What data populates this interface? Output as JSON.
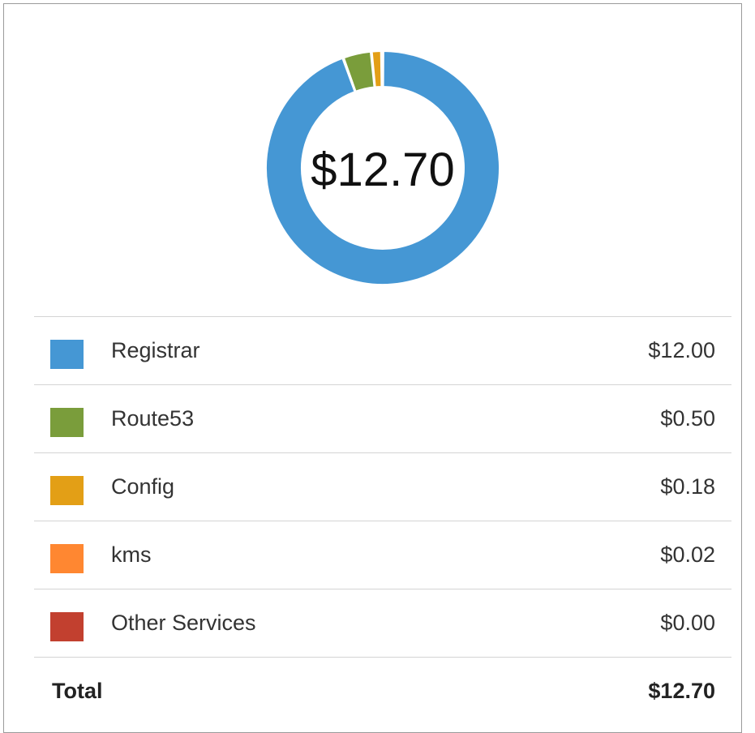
{
  "chart_data": {
    "type": "pie",
    "center_label": "$12.70",
    "categories": [
      "Registrar",
      "Route53",
      "Config",
      "kms",
      "Other Services"
    ],
    "values": [
      12.0,
      0.5,
      0.18,
      0.02,
      0.0
    ],
    "colors": [
      "#4597d4",
      "#7a9d3b",
      "#e39f16",
      "#ff8731",
      "#c2402f"
    ]
  },
  "legend": {
    "items": [
      {
        "label": "Registrar",
        "amount": "$12.00",
        "color": "#4597d4"
      },
      {
        "label": "Route53",
        "amount": "$0.50",
        "color": "#7a9d3b"
      },
      {
        "label": "Config",
        "amount": "$0.18",
        "color": "#e39f16"
      },
      {
        "label": "kms",
        "amount": "$0.02",
        "color": "#ff8731"
      },
      {
        "label": "Other Services",
        "amount": "$0.00",
        "color": "#c2402f"
      }
    ],
    "total_label": "Total",
    "total_amount": "$12.70"
  }
}
